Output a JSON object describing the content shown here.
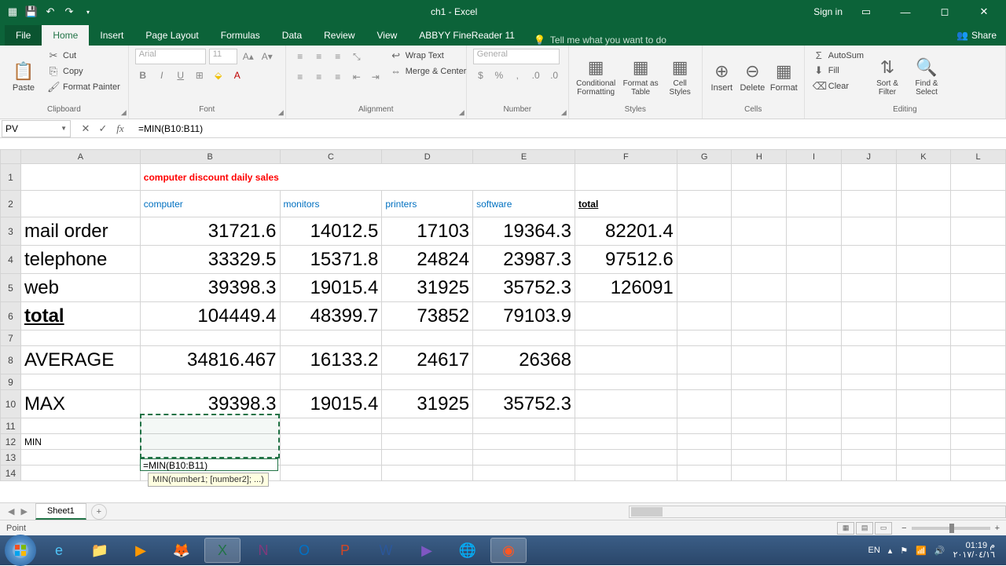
{
  "app": {
    "title": "ch1 - Excel",
    "signin": "Sign in"
  },
  "tabs": {
    "file": "File",
    "home": "Home",
    "insert": "Insert",
    "pagelayout": "Page Layout",
    "formulas": "Formulas",
    "data": "Data",
    "review": "Review",
    "view": "View",
    "abbyy": "ABBYY FineReader 11",
    "tellme": "Tell me what you want to do",
    "share": "Share"
  },
  "ribbon": {
    "clipboard": {
      "paste": "Paste",
      "cut": "Cut",
      "copy": "Copy",
      "painter": "Format Painter",
      "label": "Clipboard"
    },
    "font": {
      "name": "Arial",
      "size": "11",
      "label": "Font"
    },
    "alignment": {
      "wrap": "Wrap Text",
      "merge": "Merge & Center",
      "label": "Alignment"
    },
    "number": {
      "format": "General",
      "label": "Number"
    },
    "styles": {
      "cf": "Conditional Formatting",
      "fat": "Format as Table",
      "cs": "Cell Styles",
      "label": "Styles"
    },
    "cells": {
      "insert": "Insert",
      "delete": "Delete",
      "format": "Format",
      "label": "Cells"
    },
    "editing": {
      "sum": "AutoSum",
      "fill": "Fill",
      "clear": "Clear",
      "sort": "Sort & Filter",
      "find": "Find & Select",
      "label": "Editing"
    }
  },
  "namebox": "PV",
  "formula": "=MIN(B10:B11)",
  "cols": [
    "A",
    "B",
    "C",
    "D",
    "E",
    "F",
    "G",
    "H",
    "I",
    "J",
    "K",
    "L"
  ],
  "sheet": {
    "title": "computer discount daily sales",
    "headers": {
      "b": "computer",
      "c": "monitors",
      "d": "printers",
      "e": "software",
      "f": "total"
    },
    "rows": {
      "mail": {
        "label": "mail order",
        "b": "31721.6",
        "c": "14012.5",
        "d": "17103",
        "e": "19364.3",
        "f": "82201.4"
      },
      "tel": {
        "label": "telephone",
        "b": "33329.5",
        "c": "15371.8",
        "d": "24824",
        "e": "23987.3",
        "f": "97512.6"
      },
      "web": {
        "label": "web",
        "b": "39398.3",
        "c": "19015.4",
        "d": "31925",
        "e": "35752.3",
        "f": "126091"
      },
      "total": {
        "label": "total",
        "b": "104449.4",
        "c": "48399.7",
        "d": "73852",
        "e": "79103.9"
      }
    },
    "avg": {
      "label": "AVERAGE",
      "b": "34816.467",
      "c": "16133.2",
      "d": "24617",
      "e": "26368"
    },
    "max": {
      "label": "MAX",
      "b": "39398.3",
      "c": "19015.4",
      "d": "31925",
      "e": "35752.3"
    },
    "min": {
      "label": "MIN"
    }
  },
  "editing_cell": "=MIN(B10:B11)",
  "fn_tip": "MIN(number1; [number2]; ...)",
  "sheet_tab": "Sheet1",
  "status_mode": "Point",
  "tray": {
    "lang": "EN",
    "time": "01:19 م",
    "date": "٢٠١٧/٠٤/١٦"
  },
  "chart_data": {
    "type": "table",
    "title": "computer discount daily sales",
    "columns": [
      "",
      "computer",
      "monitors",
      "printers",
      "software",
      "total"
    ],
    "rows": [
      [
        "mail order",
        31721.6,
        14012.5,
        17103,
        19364.3,
        82201.4
      ],
      [
        "telephone",
        33329.5,
        15371.8,
        24824,
        23987.3,
        97512.6
      ],
      [
        "web",
        39398.3,
        19015.4,
        31925,
        35752.3,
        126091
      ],
      [
        "total",
        104449.4,
        48399.7,
        73852,
        79103.9,
        null
      ],
      [
        "AVERAGE",
        34816.467,
        16133.2,
        24617,
        26368,
        null
      ],
      [
        "MAX",
        39398.3,
        19015.4,
        31925,
        35752.3,
        null
      ]
    ]
  }
}
